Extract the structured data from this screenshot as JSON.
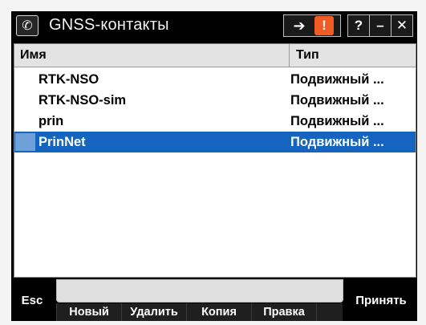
{
  "window": {
    "title": "GNSS-контакты"
  },
  "icons": {
    "app": "satellite-icon",
    "connect": "connect-icon",
    "warning": "warning-icon"
  },
  "titlebar": {
    "help": "?",
    "minimize": "–",
    "close": "✕",
    "warning": "!"
  },
  "list": {
    "columns": [
      "Имя",
      "Тип"
    ],
    "rows": [
      {
        "name": "RTK-NSO",
        "type": "Подвижный ...",
        "selected": false
      },
      {
        "name": "RTK-NSO-sim",
        "type": "Подвижный ...",
        "selected": false
      },
      {
        "name": "prin",
        "type": "Подвижный ...",
        "selected": false
      },
      {
        "name": "PrinNet",
        "type": "Подвижный ...",
        "selected": true
      }
    ]
  },
  "bottombar": {
    "esc": "Esc",
    "accept": "Принять",
    "new": "Новый",
    "delete": "Удалить",
    "copy": "Копия",
    "edit": "Правка"
  },
  "colors": {
    "selection": "#1565c0",
    "warning": "#f15a22"
  }
}
